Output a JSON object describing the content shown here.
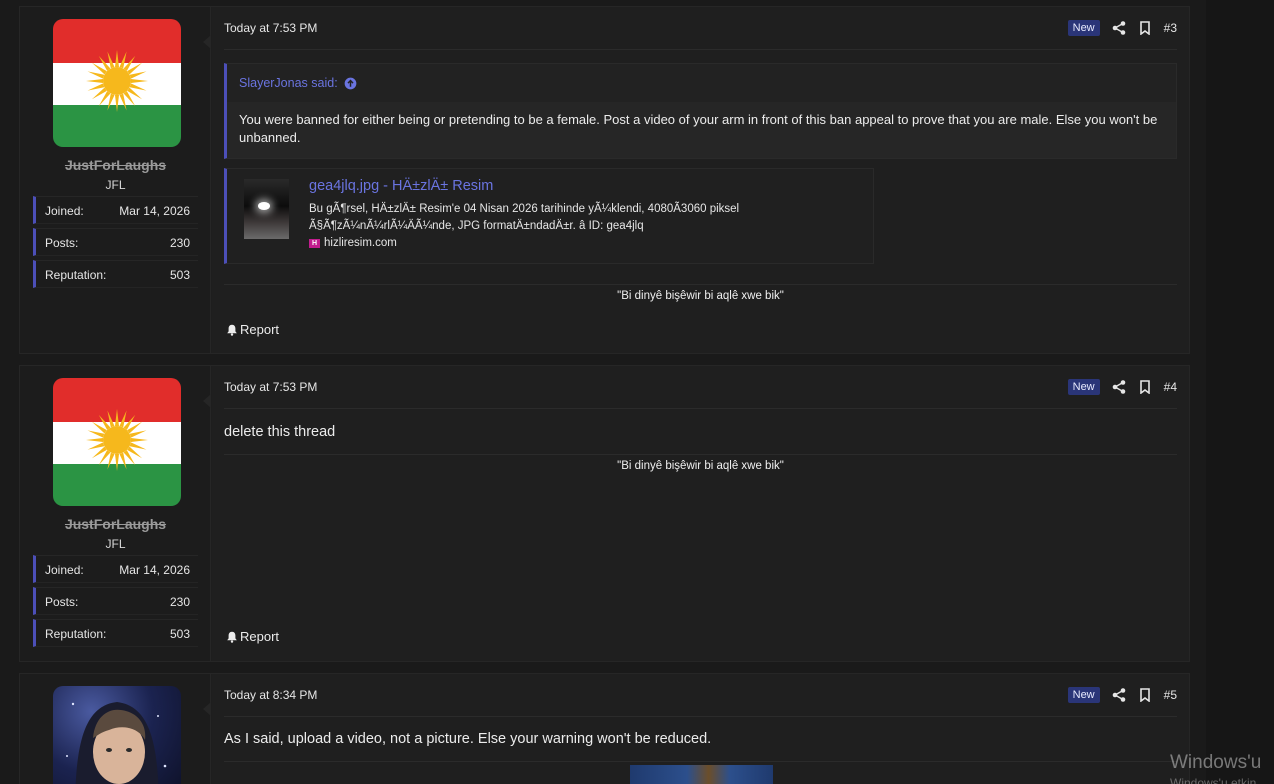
{
  "posts": [
    {
      "username": "JustForLaughs",
      "user_title": "JFL",
      "stats": [
        {
          "label": "Joined:",
          "value": "Mar 14, 2026"
        },
        {
          "label": "Posts:",
          "value": "230"
        },
        {
          "label": "Reputation:",
          "value": "503"
        }
      ],
      "timestamp": "Today at 7:53 PM",
      "badge": "New",
      "post_number": "#3",
      "quote": {
        "attribution": "SlayerJonas said:",
        "text": "You were banned for either being or pretending to be a female. Post a video of your arm in front of this ban appeal to prove that you are male. Else you won't be unbanned."
      },
      "embed": {
        "title": "gea4jlq.jpg - HÄ±zlÄ± Resim",
        "description": "Bu gÃ¶rsel, HÄ±zlÄ± Resim'e 04 Nisan 2026 tarihinde yÃ¼klendi, 4080Ã3060 piksel Ã§Ã¶zÃ¼nÃ¼rlÃ¼ÄÃ¼nde, JPG formatÄ±ndadÄ±r. â ID: gea4jlq",
        "favicon_text": "H",
        "site": "hizliresim.com"
      },
      "signature": "\"Bi dinyê bişêwir bi aqlê xwe bik\"",
      "report_label": "Report"
    },
    {
      "username": "JustForLaughs",
      "user_title": "JFL",
      "stats": [
        {
          "label": "Joined:",
          "value": "Mar 14, 2026"
        },
        {
          "label": "Posts:",
          "value": "230"
        },
        {
          "label": "Reputation:",
          "value": "503"
        }
      ],
      "timestamp": "Today at 7:53 PM",
      "badge": "New",
      "post_number": "#4",
      "message": "delete this thread",
      "signature": "\"Bi dinyê bişêwir bi aqlê xwe bik\"",
      "report_label": "Report"
    },
    {
      "timestamp": "Today at 8:34 PM",
      "badge": "New",
      "post_number": "#5",
      "message": "As I said, upload a video, not a picture. Else your warning won't be reduced."
    }
  ],
  "watermark": {
    "line1": "Windows'u",
    "line2": "Windows'u etkin"
  },
  "colors": {
    "accent": "#4c4fb8",
    "link": "#6a74e0",
    "badge_bg": "#2a3578",
    "flag_red": "#e12d2b",
    "flag_green": "#2b9444",
    "sun": "#f6b81c"
  },
  "icons": [
    "share-icon",
    "bookmark-icon",
    "arrow-up-circle-icon",
    "bell-icon",
    "kurdistan-flag-sun-icon"
  ]
}
